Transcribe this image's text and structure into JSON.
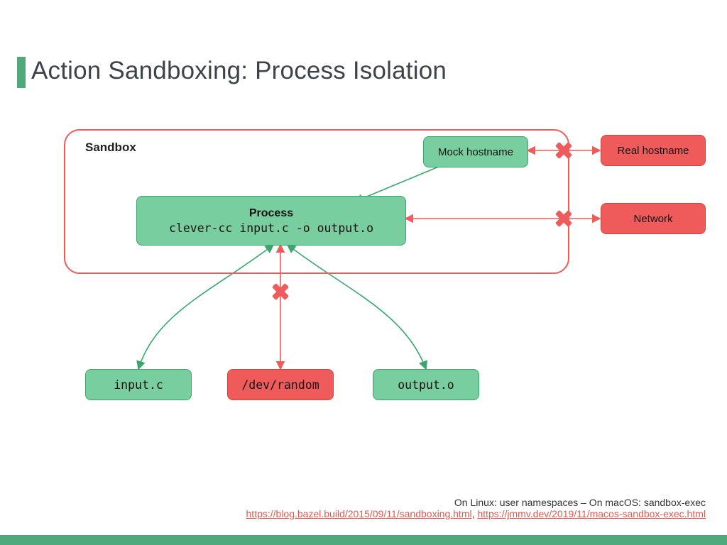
{
  "title": "Action Sandboxing: Process Isolation",
  "sandbox_label": "Sandbox",
  "process": {
    "label": "Process",
    "command": "clever-cc input.c -o output.o"
  },
  "nodes": {
    "mock_hostname": "Mock hostname",
    "real_hostname": "Real hostname",
    "network": "Network",
    "input_c": "input.c",
    "dev_random": "/dev/random",
    "output_o": "output.o"
  },
  "footnote": {
    "line1": "On Linux: user namespaces – On macOS: sandbox-exec",
    "link1": "https://blog.bazel.build/2015/09/11/sandboxing.html",
    "link2": "https://jmmv.dev/2019/11/macos-sandbox-exec.html",
    "sep": ", "
  }
}
